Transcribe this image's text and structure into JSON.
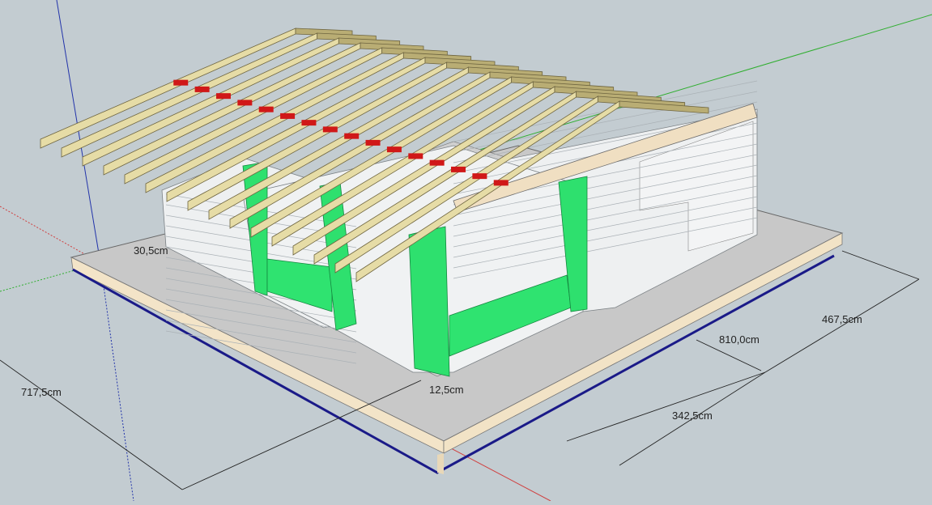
{
  "viewport": {
    "background_color": "#c3ccd1",
    "axes": {
      "red": "#d04040",
      "green": "#2fae2f",
      "blue": "#2233aa"
    }
  },
  "model": {
    "colors": {
      "block_wall": "#f1f3f4",
      "block_joint": "#b8bec2",
      "lintel_green": "#2ee06e",
      "lintel_green_dark": "#1fb556",
      "rafter_wood": "#e6dca6",
      "rafter_wood_dark": "#b9ad74",
      "ridge_red": "#d01818",
      "slab_top": "#c6c6c6",
      "slab_edge": "#f2e3c8",
      "slab_edge_line": "#1a1a88",
      "floor": "#cfcfcf"
    }
  },
  "dimensions": {
    "d1": "717,5cm",
    "d2": "810,0cm",
    "d3": "467,5cm",
    "d4": "342,5cm",
    "d5": "30,5cm",
    "d6": "12,5cm"
  }
}
